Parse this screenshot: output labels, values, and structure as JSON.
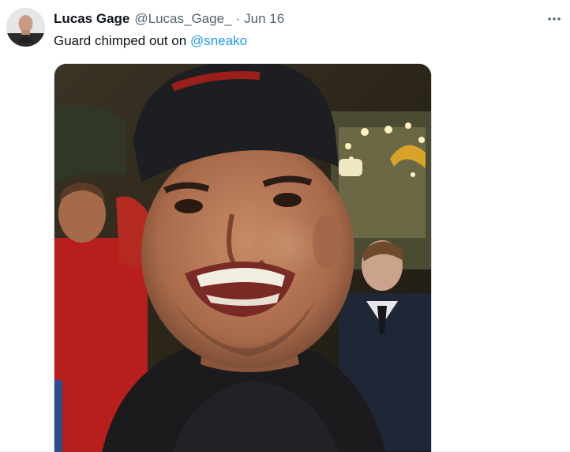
{
  "tweet": {
    "author_name": "Lucas Gage",
    "author_handle": "@Lucas_Gage_",
    "separator": "·",
    "date": "Jun 16",
    "text_prefix": "Guard chimped out on ",
    "mention": "@sneako"
  },
  "icons": {
    "more": "more-horizontal-icon"
  },
  "colors": {
    "mention": "#1d9bf0",
    "secondary_text": "#536471",
    "primary_text": "#0f1419"
  }
}
